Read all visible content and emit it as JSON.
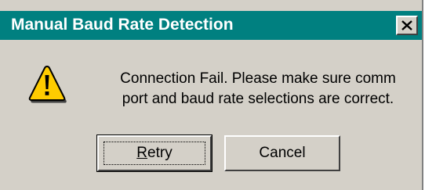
{
  "dialog": {
    "title": "Manual Baud Rate Detection",
    "message_line1": "Connection Fail.  Please make sure comm",
    "message_line2": "port and baud rate selections are correct.",
    "icon": "warning-icon",
    "close_icon": "close-icon"
  },
  "buttons": {
    "retry_accel": "R",
    "retry_rest": "etry",
    "cancel_label": "Cancel"
  },
  "colors": {
    "titlebar": "#008080",
    "face": "#d4d0c8",
    "warning_fill": "#ffcc00"
  }
}
